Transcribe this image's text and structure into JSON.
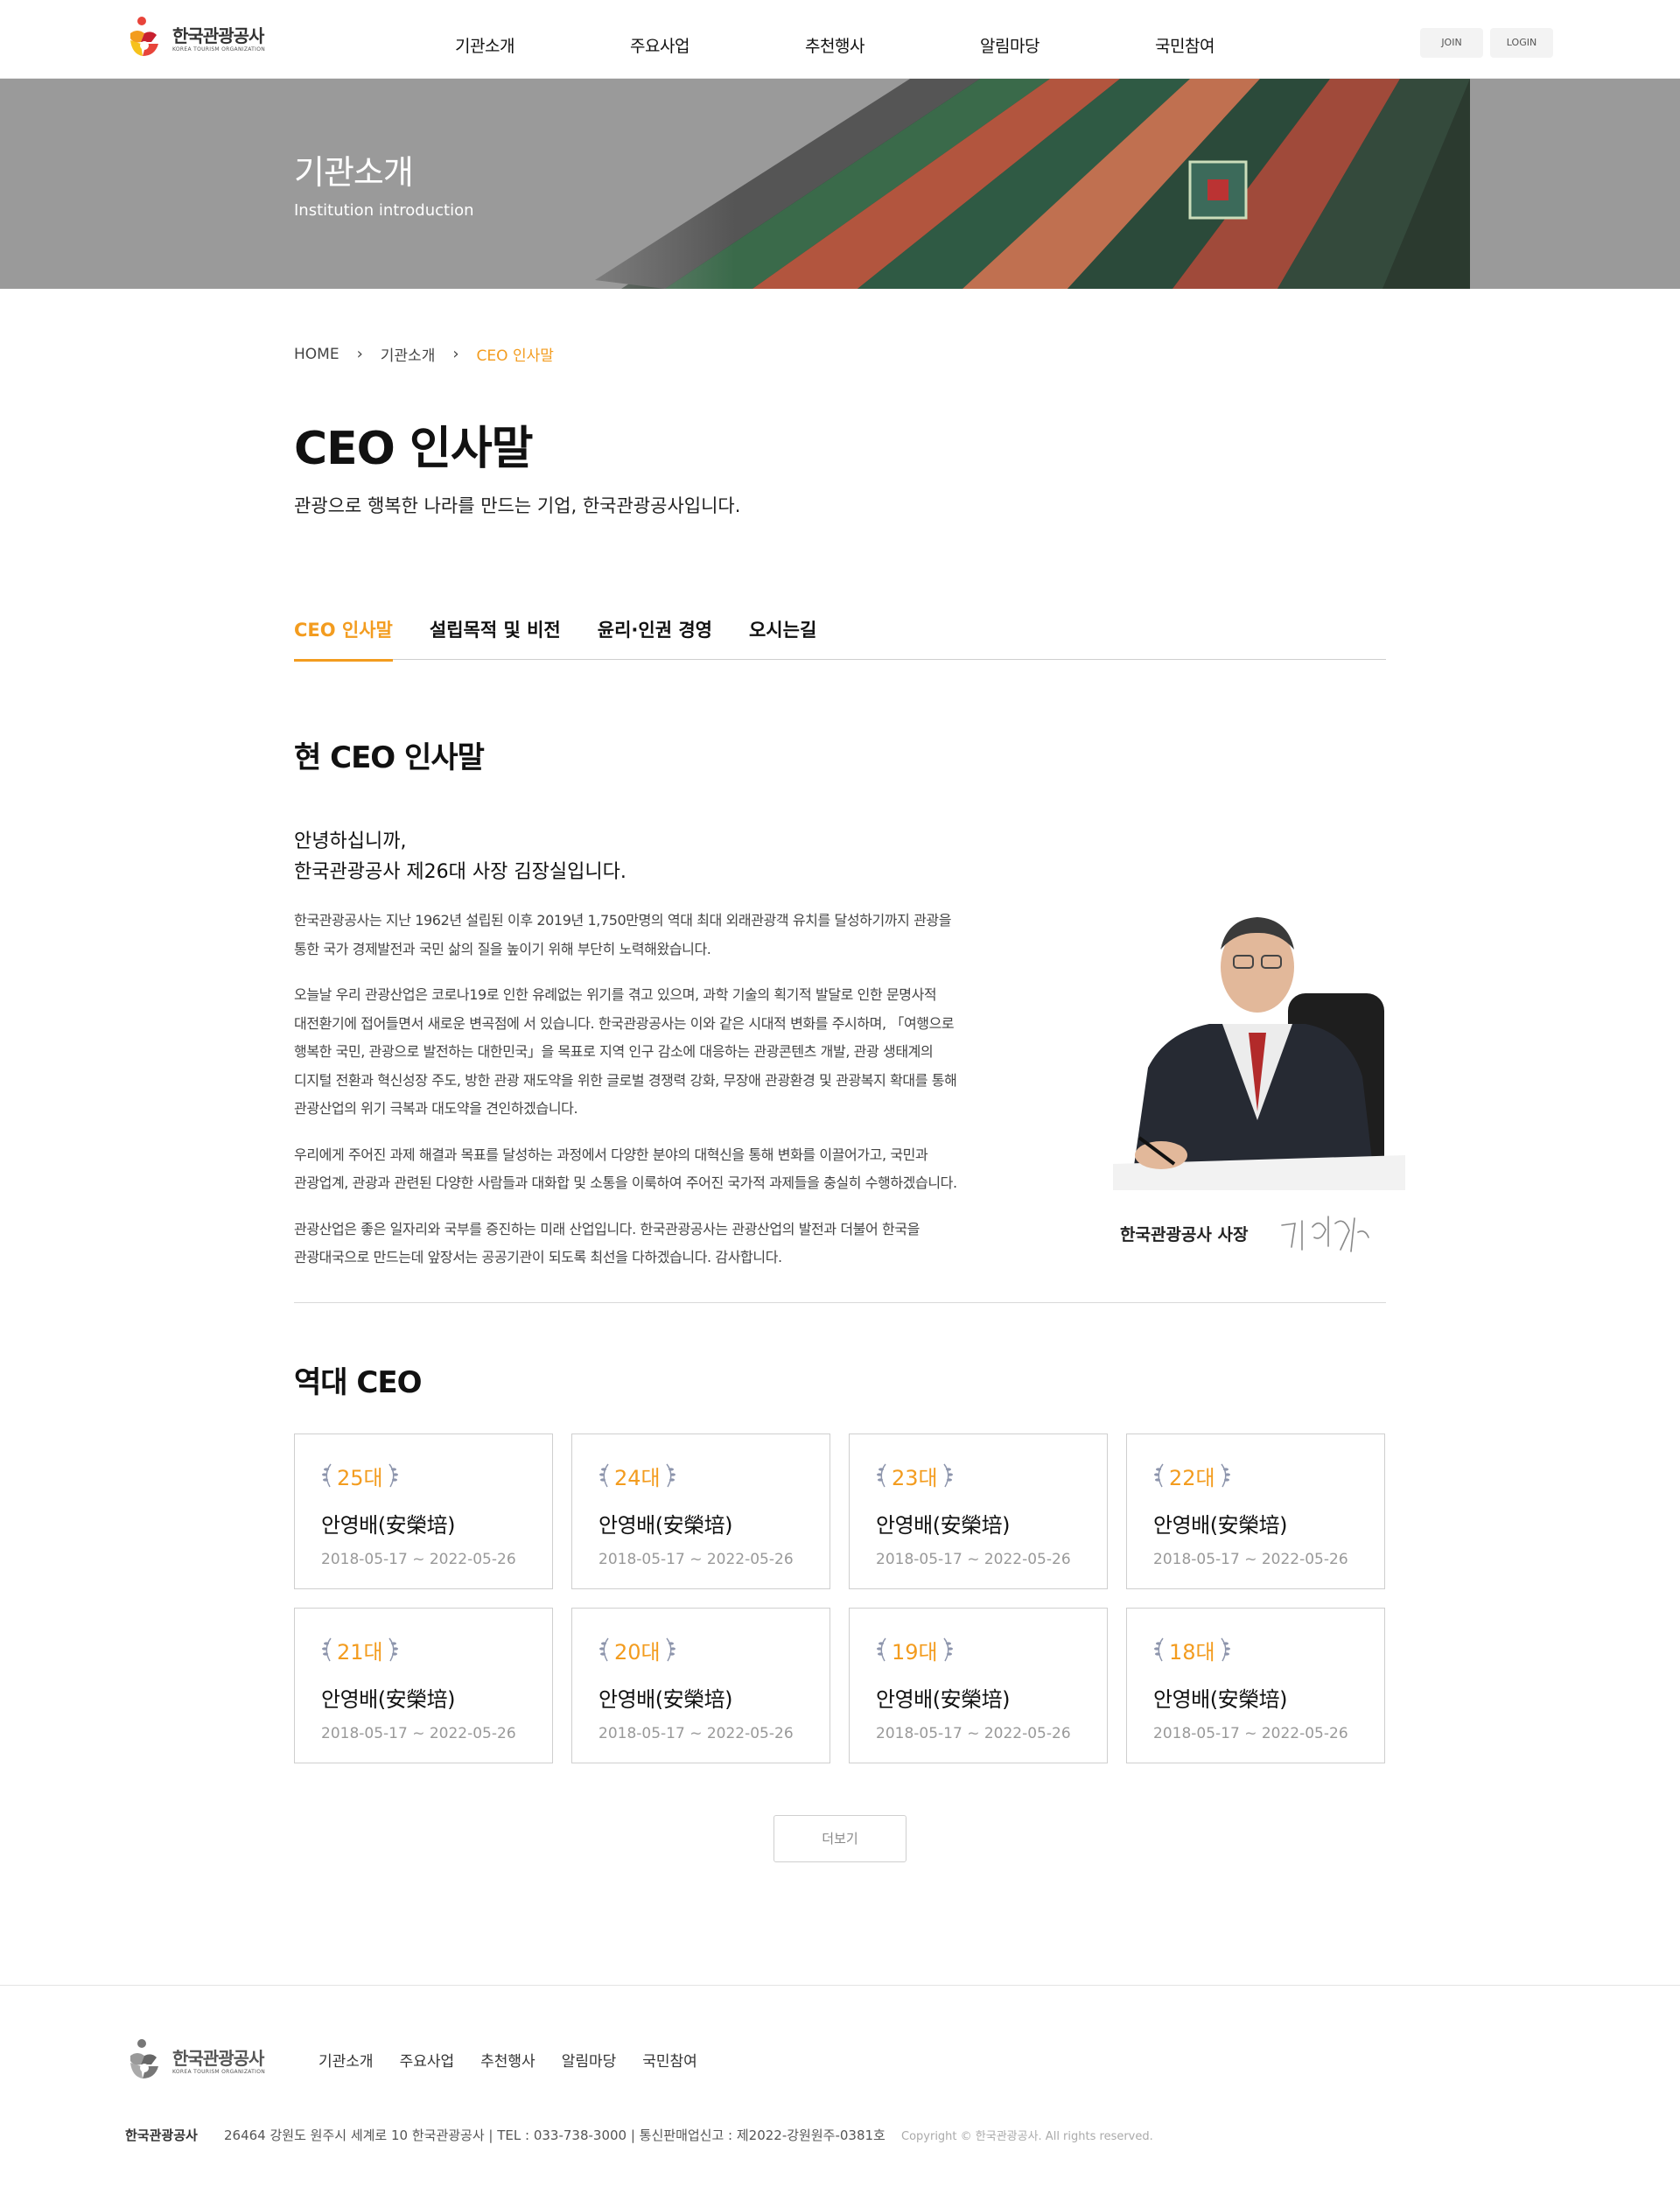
{
  "header": {
    "logo_ko": "한국관광공사",
    "logo_en": "KOREA TOURISM ORGANIZATION",
    "nav": [
      "기관소개",
      "주요사업",
      "추천행사",
      "알림마당",
      "국민참여"
    ],
    "join": "JOIN",
    "login": "LOGIN"
  },
  "banner": {
    "title": "기관소개",
    "subtitle": "Institution introduction"
  },
  "breadcrumb": {
    "home": "HOME",
    "level1": "기관소개",
    "current": "CEO 인사말"
  },
  "page": {
    "title": "CEO 인사말",
    "subtitle": "관광으로 행복한 나라를 만드는 기업, 한국관광공사입니다."
  },
  "tabs": [
    {
      "label": "CEO 인사말",
      "active": true
    },
    {
      "label": "설립목적 및 비전",
      "active": false
    },
    {
      "label": "윤리·인권 경영",
      "active": false
    },
    {
      "label": "오시는길",
      "active": false
    }
  ],
  "greeting": {
    "section_title": "현 CEO 인사말",
    "line1": "안녕하십니까,",
    "line2": "한국관광공사 제26대 사장 김장실입니다.",
    "paragraphs": [
      [
        "한국관광공사는 지난 1962년 설립된 이후 2019년 1,750만명의 역대 최대 외래관광객 유치를 달성하기까지 관광을",
        "통한 국가 경제발전과 국민 삶의 질을 높이기 위해 부단히 노력해왔습니다."
      ],
      [
        "오늘날 우리 관광산업은 코로나19로 인한 유례없는 위기를 겪고 있으며, 과학 기술의 획기적 발달로 인한 문명사적",
        "대전환기에 접어들면서 새로운 변곡점에 서 있습니다. 한국관광공사는 이와 같은 시대적 변화를 주시하며, 「여행으로",
        "행복한 국민, 관광으로 발전하는 대한민국」을 목표로 지역 인구 감소에 대응하는 관광콘텐츠 개발, 관광 생태계의",
        "디지털 전환과 혁신성장 주도, 방한 관광 재도약을 위한 글로벌 경쟁력 강화, 무장애 관광환경 및 관광복지 확대를 통해",
        "관광산업의 위기 극복과 대도약을 견인하겠습니다."
      ],
      [
        "우리에게 주어진 과제 해결과 목표를 달성하는 과정에서 다양한 분야의 대혁신을 통해 변화를 이끌어가고, 국민과",
        "관광업계, 관광과 관련된 다양한 사람들과 대화합 및 소통을 이룩하여 주어진 국가적 과제들을 충실히 수행하겠습니다."
      ],
      [
        "관광산업은 좋은 일자리와 국부를 증진하는 미래 산업입니다. 한국관광공사는 관광산업의 발전과 더불어 한국을",
        "관광대국으로 만드는데 앞장서는 공공기관이 되도록 최선을 다하겠습니다. 감사합니다."
      ]
    ],
    "caption": "한국관광공사 사장",
    "signature": "김장실"
  },
  "past_ceos": {
    "section_title": "역대 CEO",
    "items": [
      {
        "gen": "25대",
        "name": "안영배(安榮培)",
        "term": "2018-05-17 ~ 2022-05-26"
      },
      {
        "gen": "24대",
        "name": "안영배(安榮培)",
        "term": "2018-05-17 ~ 2022-05-26"
      },
      {
        "gen": "23대",
        "name": "안영배(安榮培)",
        "term": "2018-05-17 ~ 2022-05-26"
      },
      {
        "gen": "22대",
        "name": "안영배(安榮培)",
        "term": "2018-05-17 ~ 2022-05-26"
      },
      {
        "gen": "21대",
        "name": "안영배(安榮培)",
        "term": "2018-05-17 ~ 2022-05-26"
      },
      {
        "gen": "20대",
        "name": "안영배(安榮培)",
        "term": "2018-05-17 ~ 2022-05-26"
      },
      {
        "gen": "19대",
        "name": "안영배(安榮培)",
        "term": "2018-05-17 ~ 2022-05-26"
      },
      {
        "gen": "18대",
        "name": "안영배(安榮培)",
        "term": "2018-05-17 ~ 2022-05-26"
      }
    ],
    "more_label": "더보기"
  },
  "footer": {
    "logo_ko": "한국관광공사",
    "logo_en": "KOREA TOURISM ORGANIZATION",
    "nav": [
      "기관소개",
      "주요사업",
      "추천행사",
      "알림마당",
      "국민참여"
    ],
    "company": "한국관광공사",
    "address": "26464 강원도 원주시 세계로 10 한국관광공사 | TEL : 033-738-3000 | 통신판매업신고 : 제2022-강원원주-0381호",
    "copyright": "Copyright © 한국관광공사. All rights reserved."
  },
  "colors": {
    "accent": "#f39c1f",
    "banner_bg": "#9a9a9a"
  }
}
